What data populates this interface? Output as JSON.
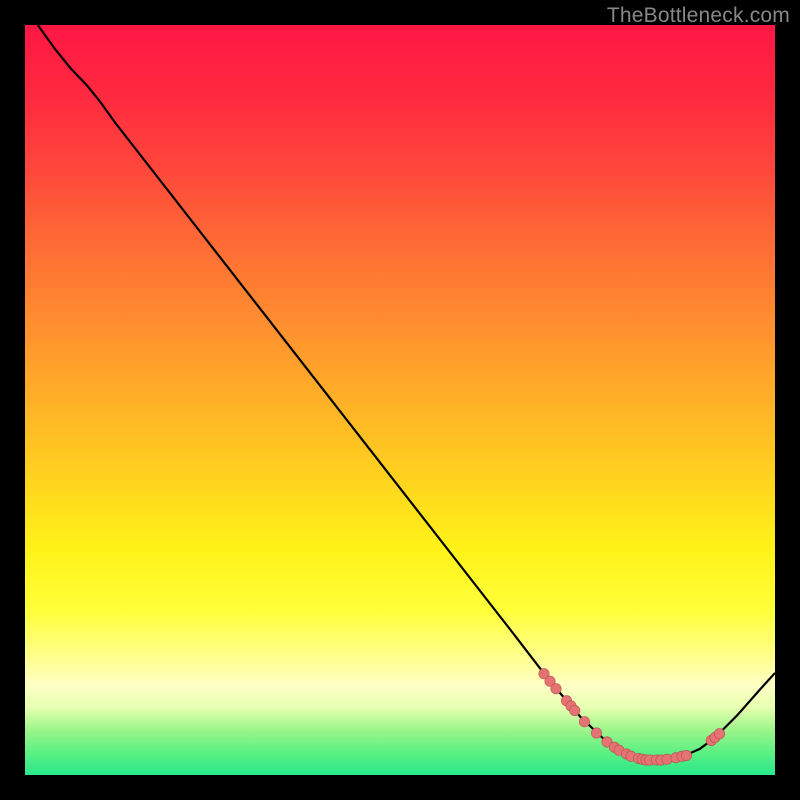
{
  "watermark_text": "TheBottleneck.com",
  "chart_data": {
    "type": "line",
    "title": "",
    "xlabel": "",
    "ylabel": "",
    "xlim": [
      0,
      100
    ],
    "ylim": [
      0,
      100
    ],
    "gradient_stops": [
      {
        "offset": 0,
        "color": "#ff1744"
      },
      {
        "offset": 10,
        "color": "#ff2b3f"
      },
      {
        "offset": 20,
        "color": "#ff4a3b"
      },
      {
        "offset": 30,
        "color": "#ff6e34"
      },
      {
        "offset": 40,
        "color": "#ff8f2f"
      },
      {
        "offset": 50,
        "color": "#ffb027"
      },
      {
        "offset": 60,
        "color": "#ffd11f"
      },
      {
        "offset": 70,
        "color": "#fff318"
      },
      {
        "offset": 78,
        "color": "#ffff3a"
      },
      {
        "offset": 84,
        "color": "#ffff8a"
      },
      {
        "offset": 88,
        "color": "#ffffc5"
      },
      {
        "offset": 91,
        "color": "#e6ffb0"
      },
      {
        "offset": 94,
        "color": "#9cf58a"
      },
      {
        "offset": 97,
        "color": "#5cf082"
      },
      {
        "offset": 100,
        "color": "#28e88a"
      }
    ],
    "curve_points": [
      {
        "x": 1.7,
        "y": 100
      },
      {
        "x": 4.0,
        "y": 96.8
      },
      {
        "x": 6.1,
        "y": 94.2
      },
      {
        "x": 8.3,
        "y": 91.9
      },
      {
        "x": 10.0,
        "y": 89.8
      },
      {
        "x": 12.0,
        "y": 87.0
      },
      {
        "x": 65.0,
        "y": 19.0
      },
      {
        "x": 70.0,
        "y": 12.5
      },
      {
        "x": 74.0,
        "y": 7.8
      },
      {
        "x": 77.5,
        "y": 4.5
      },
      {
        "x": 80.0,
        "y": 2.8
      },
      {
        "x": 82.0,
        "y": 2.1
      },
      {
        "x": 84.0,
        "y": 2.0
      },
      {
        "x": 86.0,
        "y": 2.1
      },
      {
        "x": 88.0,
        "y": 2.6
      },
      {
        "x": 90.0,
        "y": 3.5
      },
      {
        "x": 92.0,
        "y": 5.0
      },
      {
        "x": 95.0,
        "y": 8.0
      },
      {
        "x": 98.0,
        "y": 11.4
      },
      {
        "x": 100.0,
        "y": 13.6
      }
    ],
    "scatter_points": [
      {
        "x": 69.2,
        "y": 13.5
      },
      {
        "x": 70.0,
        "y": 12.5
      },
      {
        "x": 70.8,
        "y": 11.5
      },
      {
        "x": 72.2,
        "y": 9.9
      },
      {
        "x": 72.8,
        "y": 9.2
      },
      {
        "x": 73.3,
        "y": 8.6
      },
      {
        "x": 74.6,
        "y": 7.1
      },
      {
        "x": 76.2,
        "y": 5.6
      },
      {
        "x": 77.6,
        "y": 4.4
      },
      {
        "x": 78.6,
        "y": 3.7
      },
      {
        "x": 79.2,
        "y": 3.3
      },
      {
        "x": 80.2,
        "y": 2.8
      },
      {
        "x": 80.8,
        "y": 2.5
      },
      {
        "x": 81.8,
        "y": 2.2
      },
      {
        "x": 82.3,
        "y": 2.1
      },
      {
        "x": 82.8,
        "y": 2.0
      },
      {
        "x": 83.3,
        "y": 2.0
      },
      {
        "x": 84.2,
        "y": 2.0
      },
      {
        "x": 84.8,
        "y": 2.0
      },
      {
        "x": 85.6,
        "y": 2.1
      },
      {
        "x": 86.8,
        "y": 2.3
      },
      {
        "x": 87.6,
        "y": 2.5
      },
      {
        "x": 88.2,
        "y": 2.6
      },
      {
        "x": 91.5,
        "y": 4.6
      },
      {
        "x": 92.0,
        "y": 5.0
      },
      {
        "x": 92.6,
        "y": 5.5
      }
    ],
    "marker_color": "#e57373",
    "marker_stroke": "#b84e4e",
    "curve_color": "#000000"
  }
}
